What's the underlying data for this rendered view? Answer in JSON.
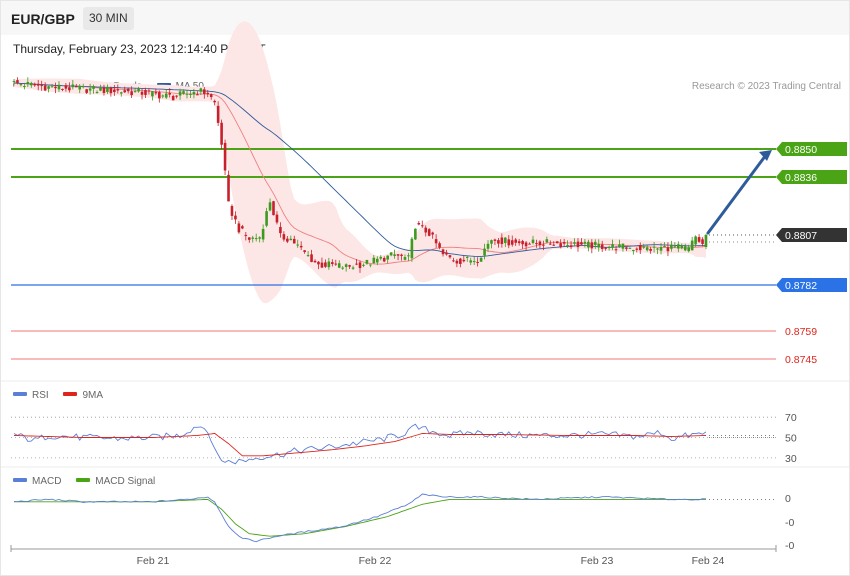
{
  "header": {
    "pair": "EUR/GBP",
    "timeframe": "30 MIN"
  },
  "datetime": "Thursday, February 23, 2023 12:14:40 PM CET",
  "copyright": "Research © 2023 Trading Central",
  "legends": {
    "price": [
      {
        "label": "MA 20 + Bollinger Bands",
        "color": "#f08080"
      },
      {
        "label": "MA 50",
        "color": "#2e5c9a"
      }
    ],
    "rsi": [
      {
        "label": "RSI",
        "color": "#5b7fd6"
      },
      {
        "label": "9MA",
        "color": "#e0241c"
      }
    ],
    "macd": [
      {
        "label": "MACD",
        "color": "#5b7fd6"
      },
      {
        "label": "MACD Signal",
        "color": "#4ba316"
      }
    ]
  },
  "colors": {
    "up": "#3c9a1f",
    "down": "#c8202b",
    "resistance": "#4ba316",
    "current": "#333333",
    "pivot": "#2a72e6",
    "support": "#e0241c",
    "support_line": "#f5a3a3",
    "band_fill": "#fde6e6",
    "arrow": "#2e5c9a"
  },
  "chart_data": {
    "type": "candlestick",
    "x_labels": [
      "Feb 21",
      "Feb 22",
      "Feb 23",
      "Feb 24"
    ],
    "price_range": [
      0.8737,
      0.8877
    ],
    "levels": [
      {
        "value": 0.885,
        "label": "0.8850",
        "kind": "resistance"
      },
      {
        "value": 0.8836,
        "label": "0.8836",
        "kind": "resistance"
      },
      {
        "value": 0.8807,
        "label": "0.8807",
        "kind": "current"
      },
      {
        "value": 0.8782,
        "label": "0.8782",
        "kind": "pivot"
      },
      {
        "value": 0.8759,
        "label": "0.8759",
        "kind": "support"
      },
      {
        "value": 0.8745,
        "label": "0.8745",
        "kind": "support"
      }
    ],
    "price_anchors": [
      [
        0,
        0.8883
      ],
      [
        10,
        0.8881
      ],
      [
        20,
        0.888
      ],
      [
        30,
        0.8879
      ],
      [
        38,
        0.8878
      ],
      [
        46,
        0.8876
      ],
      [
        53,
        0.8879
      ],
      [
        56,
        0.8878
      ],
      [
        58,
        0.8873
      ],
      [
        60,
        0.8853
      ],
      [
        62,
        0.8822
      ],
      [
        65,
        0.881
      ],
      [
        68,
        0.8805
      ],
      [
        71,
        0.8806
      ],
      [
        74,
        0.8824
      ],
      [
        77,
        0.8806
      ],
      [
        80,
        0.8805
      ],
      [
        84,
        0.8798
      ],
      [
        88,
        0.8792
      ],
      [
        92,
        0.8792
      ],
      [
        96,
        0.8791
      ],
      [
        102,
        0.8793
      ],
      [
        110,
        0.8797
      ],
      [
        114,
        0.8795
      ],
      [
        116,
        0.8812
      ],
      [
        120,
        0.8808
      ],
      [
        124,
        0.8797
      ],
      [
        128,
        0.8794
      ],
      [
        134,
        0.8795
      ],
      [
        138,
        0.8805
      ],
      [
        145,
        0.8803
      ],
      [
        155,
        0.8803
      ],
      [
        165,
        0.8802
      ],
      [
        175,
        0.8801
      ],
      [
        185,
        0.88
      ],
      [
        190,
        0.8801
      ],
      [
        195,
        0.88
      ],
      [
        197,
        0.8806
      ],
      [
        199,
        0.8802
      ],
      [
        200,
        0.8807
      ]
    ],
    "rsi": {
      "ticks": [
        70,
        50,
        30
      ],
      "range": [
        22,
        80
      ],
      "anchors": [
        [
          0,
          53
        ],
        [
          6,
          47
        ],
        [
          10,
          52
        ],
        [
          20,
          50
        ],
        [
          30,
          49
        ],
        [
          40,
          50
        ],
        [
          48,
          52
        ],
        [
          53,
          62
        ],
        [
          56,
          58
        ],
        [
          58,
          36
        ],
        [
          61,
          26
        ],
        [
          66,
          27
        ],
        [
          71,
          31
        ],
        [
          76,
          33
        ],
        [
          82,
          37
        ],
        [
          90,
          40
        ],
        [
          98,
          44
        ],
        [
          106,
          48
        ],
        [
          112,
          53
        ],
        [
          116,
          60
        ],
        [
          121,
          56
        ],
        [
          126,
          52
        ],
        [
          132,
          55
        ],
        [
          140,
          53
        ],
        [
          150,
          52
        ],
        [
          160,
          52
        ],
        [
          170,
          53
        ],
        [
          180,
          51
        ],
        [
          187,
          55
        ],
        [
          190,
          49
        ],
        [
          195,
          52
        ],
        [
          200,
          54
        ]
      ],
      "ma_anchors": [
        [
          0,
          52
        ],
        [
          20,
          50
        ],
        [
          40,
          50
        ],
        [
          53,
          52
        ],
        [
          58,
          54
        ],
        [
          62,
          44
        ],
        [
          66,
          32
        ],
        [
          72,
          32
        ],
        [
          82,
          35
        ],
        [
          92,
          38
        ],
        [
          102,
          42
        ],
        [
          110,
          46
        ],
        [
          118,
          54
        ],
        [
          126,
          53
        ],
        [
          140,
          53
        ],
        [
          160,
          52
        ],
        [
          180,
          52
        ],
        [
          190,
          51
        ],
        [
          200,
          52
        ]
      ]
    },
    "macd": {
      "ticks": [
        "0",
        "-0",
        "-0"
      ],
      "range": [
        -0.0018,
        0.0004
      ],
      "anchors": [
        [
          0,
          0.0
        ],
        [
          10,
          0.0001
        ],
        [
          20,
          0.0
        ],
        [
          30,
          0.0
        ],
        [
          40,
          0.0
        ],
        [
          50,
          0.0001
        ],
        [
          56,
          0.0002
        ],
        [
          58,
          0.0
        ],
        [
          62,
          -0.001
        ],
        [
          66,
          -0.0015
        ],
        [
          70,
          -0.0016
        ],
        [
          76,
          -0.0014
        ],
        [
          85,
          -0.0012
        ],
        [
          95,
          -0.001
        ],
        [
          105,
          -0.0006
        ],
        [
          114,
          -0.0001
        ],
        [
          118,
          0.0003
        ],
        [
          124,
          0.0002
        ],
        [
          134,
          0.0002
        ],
        [
          150,
          0.0001
        ],
        [
          170,
          0.0002
        ],
        [
          190,
          0.0001
        ],
        [
          200,
          0.0001
        ]
      ],
      "signal_anchors": [
        [
          0,
          0.0
        ],
        [
          20,
          0.0
        ],
        [
          40,
          0.0
        ],
        [
          56,
          0.0001
        ],
        [
          60,
          -0.0003
        ],
        [
          64,
          -0.0009
        ],
        [
          68,
          -0.0013
        ],
        [
          74,
          -0.0014
        ],
        [
          84,
          -0.0013
        ],
        [
          96,
          -0.001
        ],
        [
          108,
          -0.0006
        ],
        [
          118,
          -0.0001
        ],
        [
          126,
          0.0001
        ],
        [
          140,
          0.0001
        ],
        [
          170,
          0.0001
        ],
        [
          200,
          0.0001
        ]
      ]
    }
  }
}
